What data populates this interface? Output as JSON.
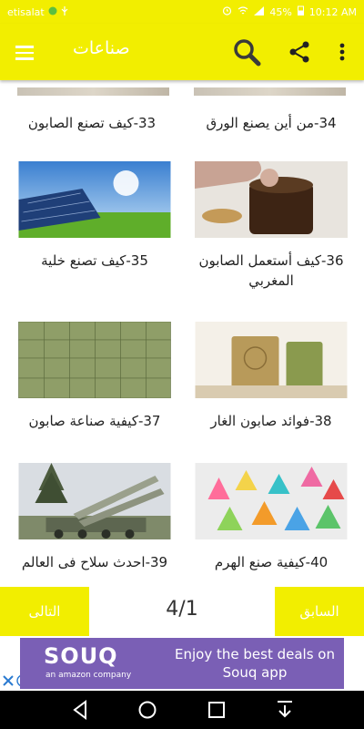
{
  "status_bar": {
    "carrier": "etisalat",
    "battery_percent": "45%",
    "time": "10:12 AM"
  },
  "app_bar": {
    "title": "صناعات",
    "background_color": "#f2ee00"
  },
  "cards": [
    {
      "id": "33",
      "title": "33-كيف تصنع الصابون"
    },
    {
      "id": "34",
      "title": "34-من أين يصنع الورق"
    },
    {
      "id": "35",
      "title": "35-كيف تصنع خلية"
    },
    {
      "id": "36",
      "title": "36-كيف أستعمل الصابون المغربي"
    },
    {
      "id": "37",
      "title": "37-كيفية صناعة صابون"
    },
    {
      "id": "38",
      "title": "38-فوائد صابون الغار"
    },
    {
      "id": "39",
      "title": "39-احدث سلاح فى العالم"
    },
    {
      "id": "40",
      "title": "40-كيفية صنع الهرم"
    }
  ],
  "pagination": {
    "next_label": "التالى",
    "page_indicator": "4/1",
    "previous_label": "السابق"
  },
  "ad": {
    "brand": "SOUQ",
    "brand_sub": "an amazon company",
    "headline": "Enjoy the best deals on Souq app"
  },
  "icons": {
    "menu": "hamburger-menu-icon",
    "search": "search-icon",
    "share": "share-icon",
    "more": "more-vert-icon"
  }
}
